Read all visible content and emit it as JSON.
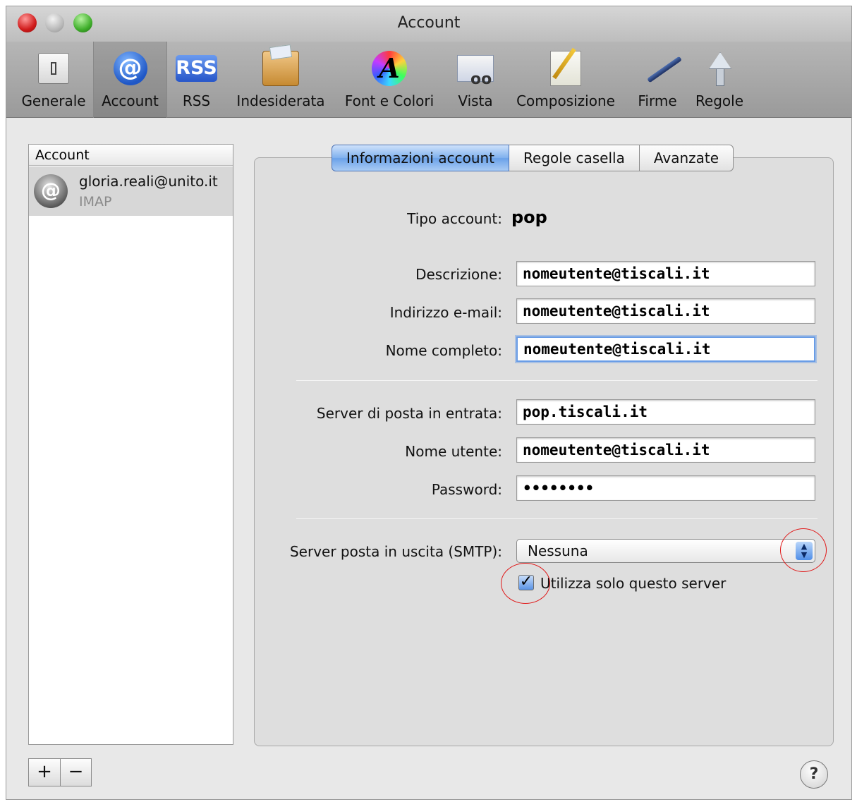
{
  "window": {
    "title": "Account"
  },
  "toolbar": {
    "items": [
      {
        "label": "Generale"
      },
      {
        "label": "Account"
      },
      {
        "label": "RSS"
      },
      {
        "label": "Indesiderata"
      },
      {
        "label": "Font e Colori"
      },
      {
        "label": "Vista"
      },
      {
        "label": "Composizione"
      },
      {
        "label": "Firme"
      },
      {
        "label": "Regole"
      }
    ],
    "rss_icon_text": "RSS",
    "at_icon_text": "@",
    "font_icon_text": "A"
  },
  "sidebar": {
    "header": "Account",
    "accounts": [
      {
        "email": "gloria.reali@unito.it",
        "type": "IMAP",
        "avatar_glyph": "@"
      }
    ],
    "add_label": "+",
    "remove_label": "−"
  },
  "tabs": [
    {
      "label": "Informazioni account",
      "active": true
    },
    {
      "label": "Regole casella",
      "active": false
    },
    {
      "label": "Avanzate",
      "active": false
    }
  ],
  "form": {
    "tipo_account_label": "Tipo account:",
    "tipo_account_value": "pop",
    "descrizione_label": "Descrizione:",
    "descrizione_value": "nomeutente@tiscali.it",
    "email_label": "Indirizzo e-mail:",
    "email_value": "nomeutente@tiscali.it",
    "nome_label": "Nome completo:",
    "nome_value": "nomeutente@tiscali.it",
    "server_in_label": "Server di posta in entrata:",
    "server_in_value": "pop.tiscali.it",
    "utente_label": "Nome utente:",
    "utente_value": "nomeutente@tiscali.it",
    "password_label": "Password:",
    "password_value": "••••••••",
    "smtp_label": "Server posta in uscita (SMTP):",
    "smtp_value": "Nessuna",
    "only_server_label": "Utilizza solo questo server",
    "only_server_checked": true
  },
  "help_label": "?",
  "colors": {
    "accent_blue": "#6aa1e9",
    "annotation_red": "#e01818"
  }
}
